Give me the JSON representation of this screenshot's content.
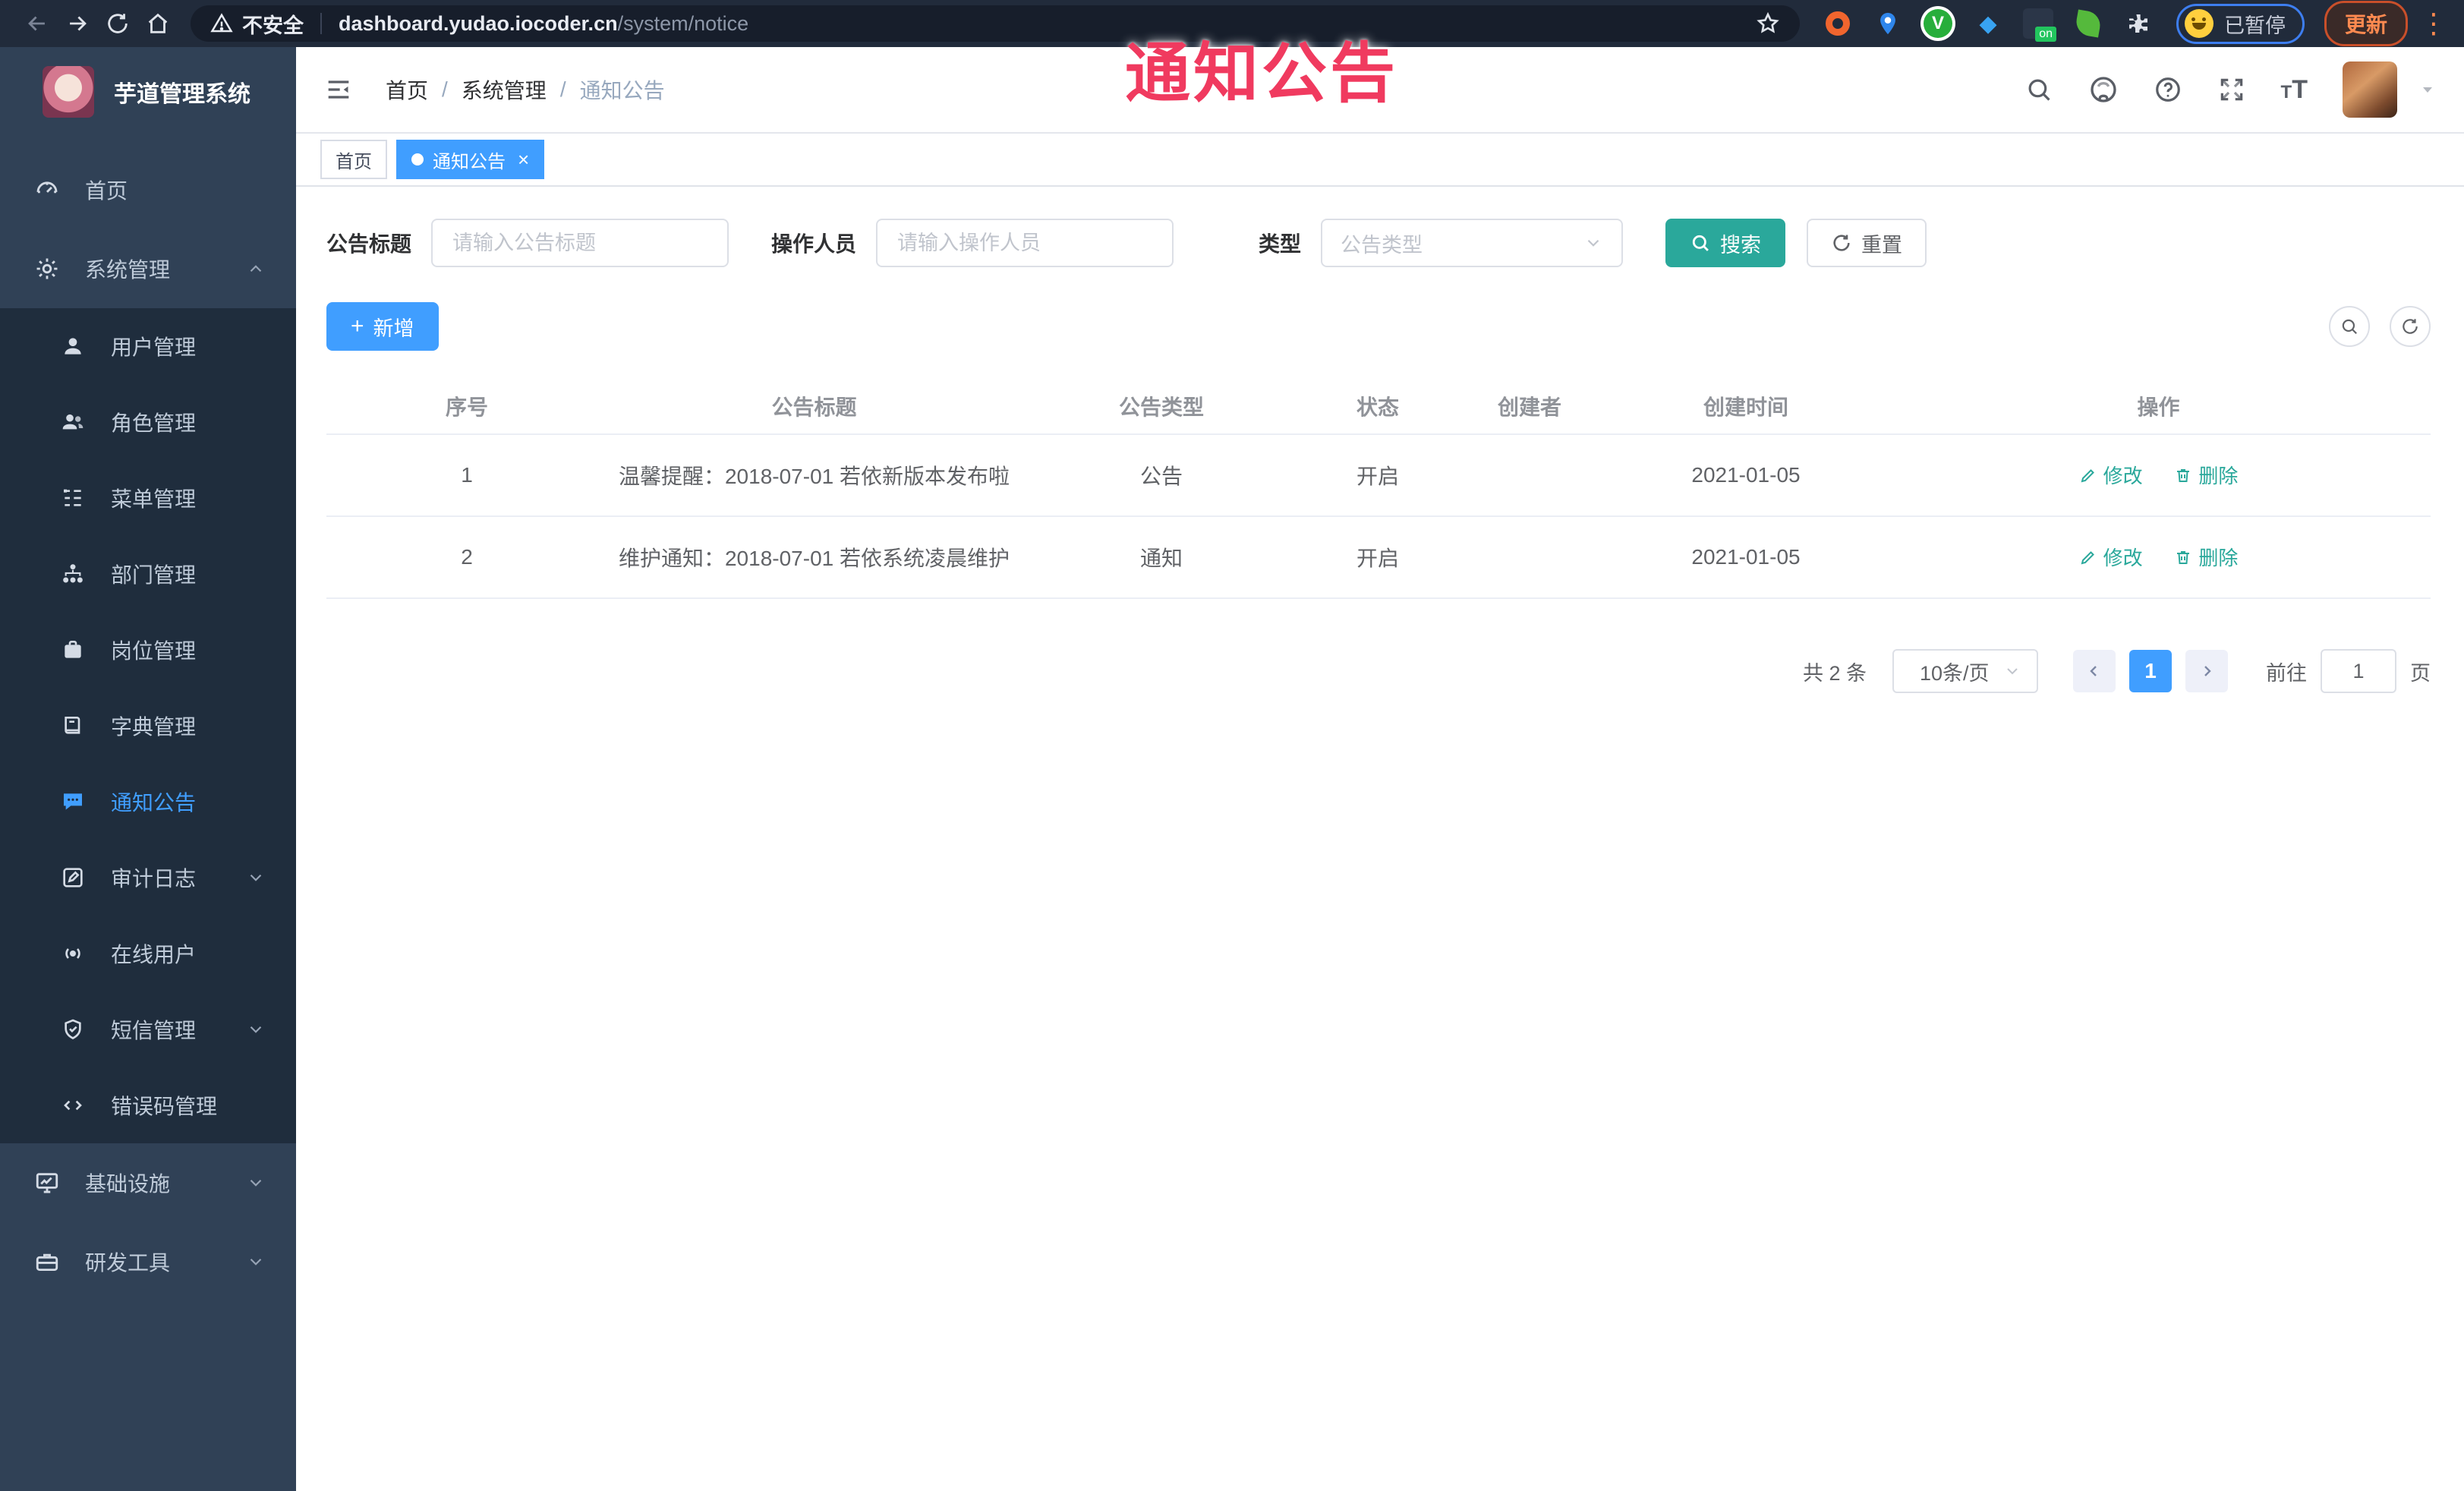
{
  "browser": {
    "security_label": "不安全",
    "url_host": "dashboard.yudao.iocoder.cn",
    "url_path": "/system/notice",
    "paused_label": "已暂停",
    "update_label": "更新"
  },
  "overlay": {
    "title": "通知公告",
    "color": "#f03a5f"
  },
  "sidebar": {
    "app_title": "芋道管理系统",
    "items": {
      "home": {
        "label": "首页"
      },
      "system": {
        "label": "系统管理"
      },
      "user": {
        "label": "用户管理"
      },
      "role": {
        "label": "角色管理"
      },
      "menu": {
        "label": "菜单管理"
      },
      "dept": {
        "label": "部门管理"
      },
      "post": {
        "label": "岗位管理"
      },
      "dict": {
        "label": "字典管理"
      },
      "notice": {
        "label": "通知公告"
      },
      "audit": {
        "label": "审计日志"
      },
      "online": {
        "label": "在线用户"
      },
      "sms": {
        "label": "短信管理"
      },
      "errcode": {
        "label": "错误码管理"
      },
      "infra": {
        "label": "基础设施"
      },
      "devtools": {
        "label": "研发工具"
      }
    }
  },
  "header": {
    "breadcrumb": {
      "first": "首页",
      "second": "系统管理",
      "last": "通知公告"
    }
  },
  "tags": {
    "home": "首页",
    "active": "通知公告"
  },
  "filters": {
    "title_label": "公告标题",
    "title_placeholder": "请输入公告标题",
    "operator_label": "操作人员",
    "operator_placeholder": "请输入操作人员",
    "type_label": "类型",
    "type_placeholder": "公告类型",
    "search_label": "搜索",
    "reset_label": "重置"
  },
  "toolbar": {
    "add_label": "新增"
  },
  "table": {
    "columns": {
      "no": "序号",
      "title": "公告标题",
      "type": "公告类型",
      "status": "状态",
      "creator": "创建者",
      "created": "创建时间",
      "op": "操作"
    },
    "rows": [
      {
        "no": "1",
        "title": "温馨提醒：2018-07-01 若依新版本发布啦",
        "type": "公告",
        "status": "开启",
        "creator": "",
        "created": "2021-01-05"
      },
      {
        "no": "2",
        "title": "维护通知：2018-07-01 若依系统凌晨维护",
        "type": "通知",
        "status": "开启",
        "creator": "",
        "created": "2021-01-05"
      }
    ],
    "edit_label": "修改",
    "delete_label": "删除"
  },
  "pagination": {
    "total": "共 2 条",
    "page_size": "10条/页",
    "current": "1",
    "goto_label": "前往",
    "goto_value": "1",
    "page_label": "页"
  },
  "colors": {
    "accent_blue": "#409eff",
    "action_teal": "#2aa89b",
    "overlay_red": "#f03a5f",
    "sidebar_bg": "#304156",
    "submenu_bg": "#1f2d3d"
  }
}
